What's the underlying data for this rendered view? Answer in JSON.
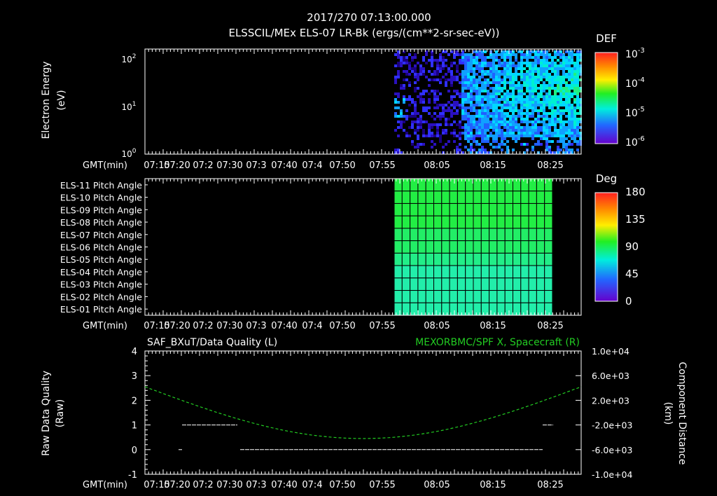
{
  "header": {
    "title": "2017/270  07:13:00.000",
    "subtitle": "ELSSCIL/MEx ELS-07 LR-Bk   (ergs/(cm**2-sr-sec-eV))"
  },
  "time_axis": {
    "label": "GMT(min)",
    "ticks": [
      "07:15",
      "07:20",
      "07:2",
      "07:30",
      "07:3",
      "07:40",
      "07:4",
      "07:50",
      "07:55",
      "08:05",
      "08:15",
      "08:25"
    ]
  },
  "panel1": {
    "ylabel_line1": "Electron Energy",
    "ylabel_line2": "(eV)",
    "yticks": [
      {
        "base": "10",
        "exp": "2"
      },
      {
        "base": "10",
        "exp": "1"
      },
      {
        "base": "10",
        "exp": "0"
      }
    ],
    "colorbar_title": "DEF",
    "colorbar_ticks": [
      {
        "base": "10",
        "exp": "-3"
      },
      {
        "base": "10",
        "exp": "-4"
      },
      {
        "base": "10",
        "exp": "-5"
      },
      {
        "base": "10",
        "exp": "-6"
      }
    ]
  },
  "panel2": {
    "row_labels": [
      "ELS-11 Pitch Angle",
      "ELS-10 Pitch Angle",
      "ELS-09 Pitch Angle",
      "ELS-08 Pitch Angle",
      "ELS-07 Pitch Angle",
      "ELS-06 Pitch Angle",
      "ELS-05 Pitch Angle",
      "ELS-04 Pitch Angle",
      "ELS-03 Pitch Angle",
      "ELS-02 Pitch Angle",
      "ELS-01 Pitch Angle"
    ],
    "colorbar_title": "Deg",
    "colorbar_ticks": [
      "180",
      "135",
      "90",
      "45",
      "0"
    ]
  },
  "panel3": {
    "title_left": "SAF_BXuT/Data Quality (L)",
    "title_right": "MEXORBMC/SPF X, Spacecraft (R)",
    "ylabel_left_1": "Raw Data Quality",
    "ylabel_left_2": "(Raw)",
    "ylabel_right_1": "Component Distance",
    "ylabel_right_2": "(km)",
    "left_ticks": [
      "4",
      "3",
      "2",
      "1",
      "0",
      "-1"
    ],
    "right_ticks": [
      "1.0e+04",
      "6.0e+03",
      "2.0e+03",
      "-2.0e+03",
      "-6.0e+03",
      "-1.0e+04"
    ]
  },
  "colors": {
    "background": "#000000",
    "axes": "#ffffff",
    "spf_x_line": "#22cc22",
    "quality_line": "#ffffff",
    "pitch_fill_high": "#22ee44",
    "pitch_fill_low": "#22eeaa"
  },
  "chart_data": [
    {
      "type": "heatmap",
      "title": "ELSSCIL/MEx ELS-07 LR-Bk   (ergs/(cm**2-sr-sec-eV))",
      "xlabel": "GMT(min)",
      "ylabel": "Electron Energy (eV)",
      "y_scale": "log",
      "ylim": [
        1,
        150
      ],
      "colorbar": {
        "label": "DEF",
        "scale": "log",
        "range": [
          1e-06,
          0.001
        ]
      },
      "data_start": "07:54",
      "notes_visible": "no data before ~07:54; intensity increases toward 08:25 at ~20 eV"
    },
    {
      "type": "heatmap",
      "xlabel": "GMT(min)",
      "rows": [
        "ELS-11",
        "ELS-10",
        "ELS-09",
        "ELS-08",
        "ELS-07",
        "ELS-06",
        "ELS-05",
        "ELS-04",
        "ELS-03",
        "ELS-02",
        "ELS-01"
      ],
      "colorbar": {
        "label": "Deg",
        "range": [
          0,
          180
        ]
      },
      "data_time_range": [
        "07:54",
        "08:25"
      ],
      "row_values_deg": [
        95,
        95,
        95,
        95,
        90,
        90,
        85,
        75,
        75,
        75,
        75
      ]
    },
    {
      "type": "line",
      "series": [
        {
          "name": "SAF_BXuT/Data Quality",
          "axis": "left",
          "points": [
            [
              7.33,
              1
            ],
            [
              7.5,
              1
            ],
            [
              7.5,
              0
            ],
            [
              8.45,
              0
            ],
            [
              8.55,
              1
            ]
          ]
        },
        {
          "name": "MEXORBMC/SPF X, Spacecraft",
          "axis": "right",
          "x": [
            0,
            0.2,
            0.4,
            0.6,
            0.8,
            1.0
          ],
          "values": [
            4200,
            -900,
            -4100,
            -4200,
            -900,
            4200
          ]
        }
      ],
      "ylim_left": [
        -1,
        4
      ],
      "ylim_right": [
        -10000,
        10000
      ]
    }
  ]
}
